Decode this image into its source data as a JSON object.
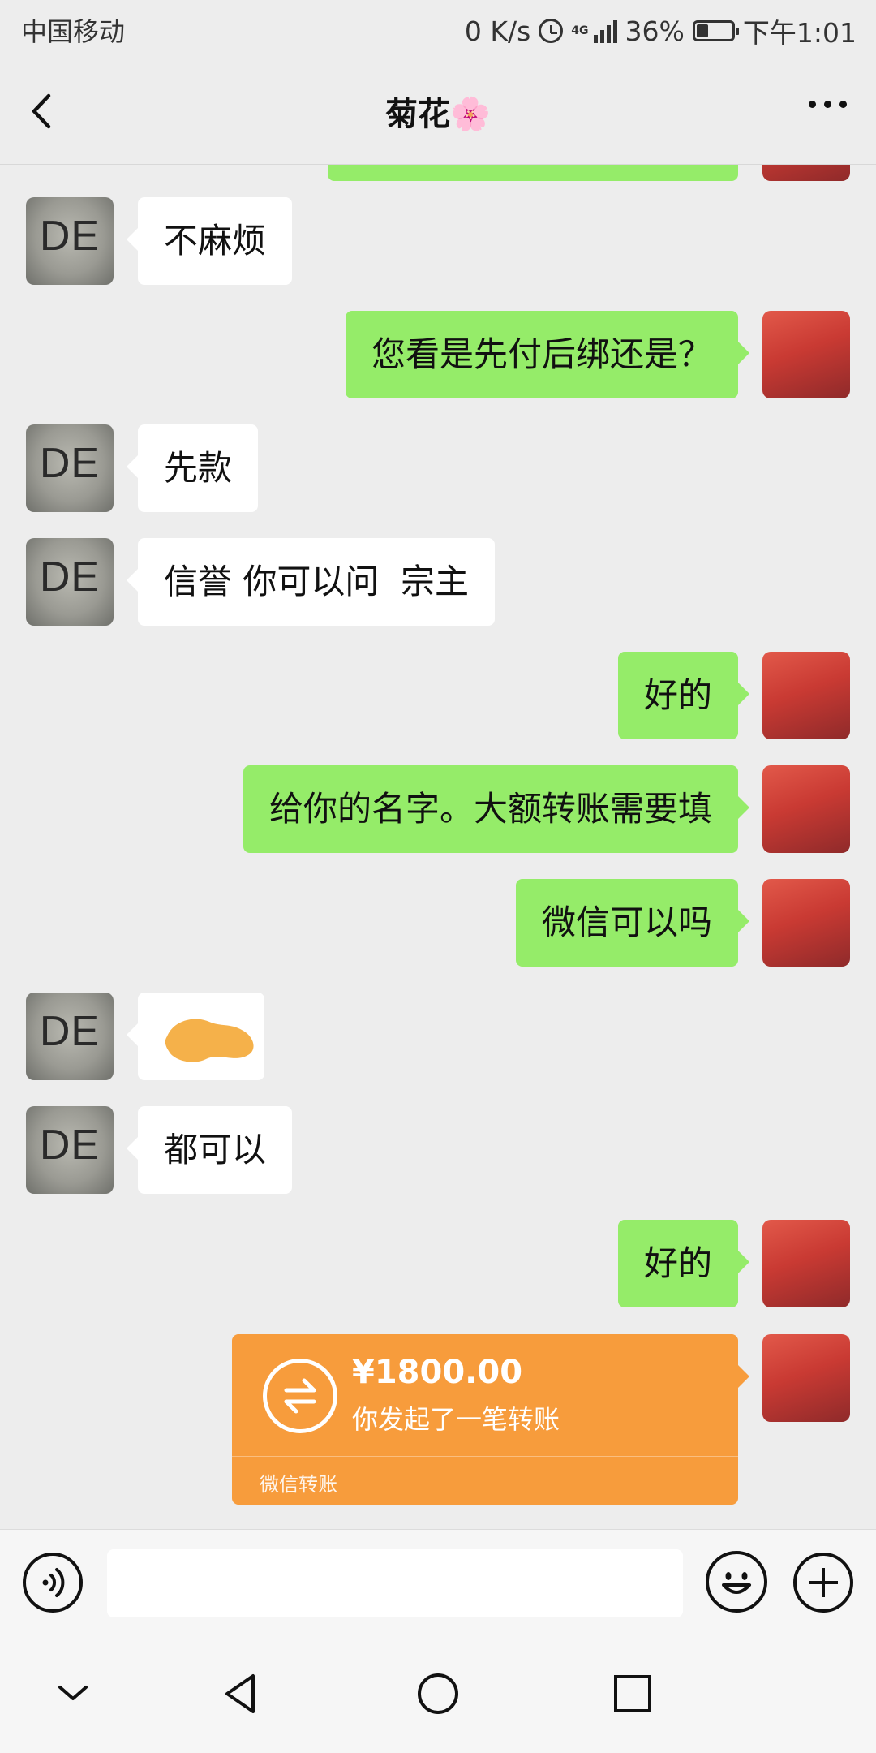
{
  "status_bar": {
    "carrier": "中国移动",
    "speed": "0 K/s",
    "network": "4G",
    "battery": "36%",
    "time": "下午1:01"
  },
  "header": {
    "title": "菊花🌸"
  },
  "contact_avatar": {
    "text": "DE"
  },
  "messages": [
    {
      "side": "left",
      "text": "不麻烦"
    },
    {
      "side": "right",
      "text": "您看是先付后绑还是？"
    },
    {
      "side": "left",
      "text": "先款"
    },
    {
      "side": "left",
      "text": "信誉 你可以问  宗主"
    },
    {
      "side": "right",
      "text": "好的"
    },
    {
      "side": "right",
      "text": "给你的名字。大额转账需要填"
    },
    {
      "side": "right",
      "text": "微信可以吗"
    },
    {
      "side": "left",
      "text": "",
      "redacted": true
    },
    {
      "side": "left",
      "text": "都可以"
    },
    {
      "side": "right",
      "text": "好的"
    }
  ],
  "transfer": {
    "amount": "¥1800.00",
    "description": "你发起了一笔转账",
    "footer": "微信转账"
  },
  "input_bar": {
    "voice_icon": "voice-icon",
    "emoji_icon": "emoji-icon",
    "plus_icon": "plus-icon"
  },
  "colors": {
    "background": "#ededed",
    "sent_bubble": "#95ec69",
    "received_bubble": "#ffffff",
    "transfer_card": "#f79c3c"
  }
}
